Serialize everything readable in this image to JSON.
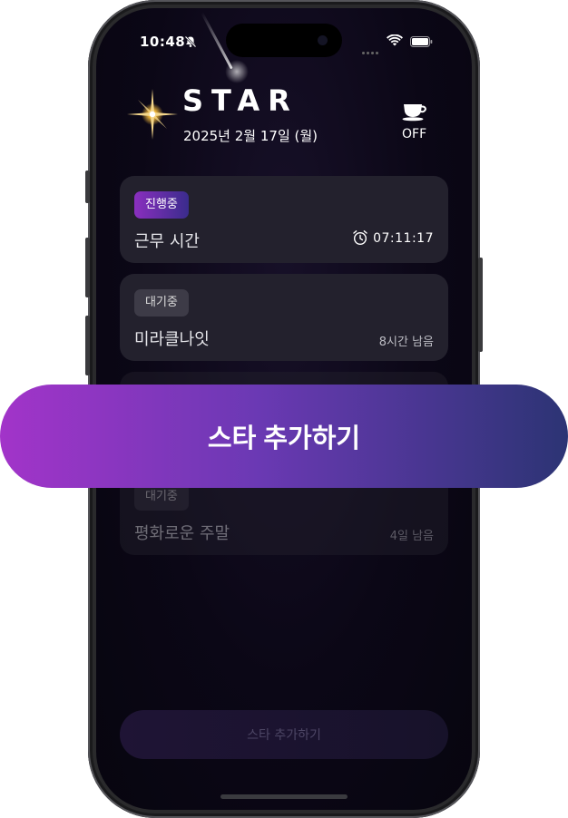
{
  "status_bar": {
    "time": "10:48",
    "icons": [
      "bell-slash-icon",
      "cellular-icon",
      "wifi-icon",
      "battery-icon"
    ]
  },
  "header": {
    "title": "STAR",
    "date": "2025년 2월 17일 (월)",
    "icon": "coffee-cup-icon",
    "toggle_label": "OFF"
  },
  "cards": [
    {
      "badge": "진행중",
      "title": "근무 시간",
      "meta": "07:11:17",
      "icon": "alarm-clock-icon"
    },
    {
      "badge": "대기중",
      "title": "미라클나잇",
      "meta": "8시간 남음"
    },
    {
      "badge": "대기중",
      "title": "평화로운 주말",
      "meta": "4일 남음"
    }
  ],
  "hero_button": {
    "label": "스타 추가하기"
  },
  "bottom_button": {
    "label": "스타 추가하기"
  },
  "colors": {
    "background": "#0b0716",
    "card": "#23212d",
    "accent_start": "#a234c9",
    "accent_end": "#2c3474"
  }
}
